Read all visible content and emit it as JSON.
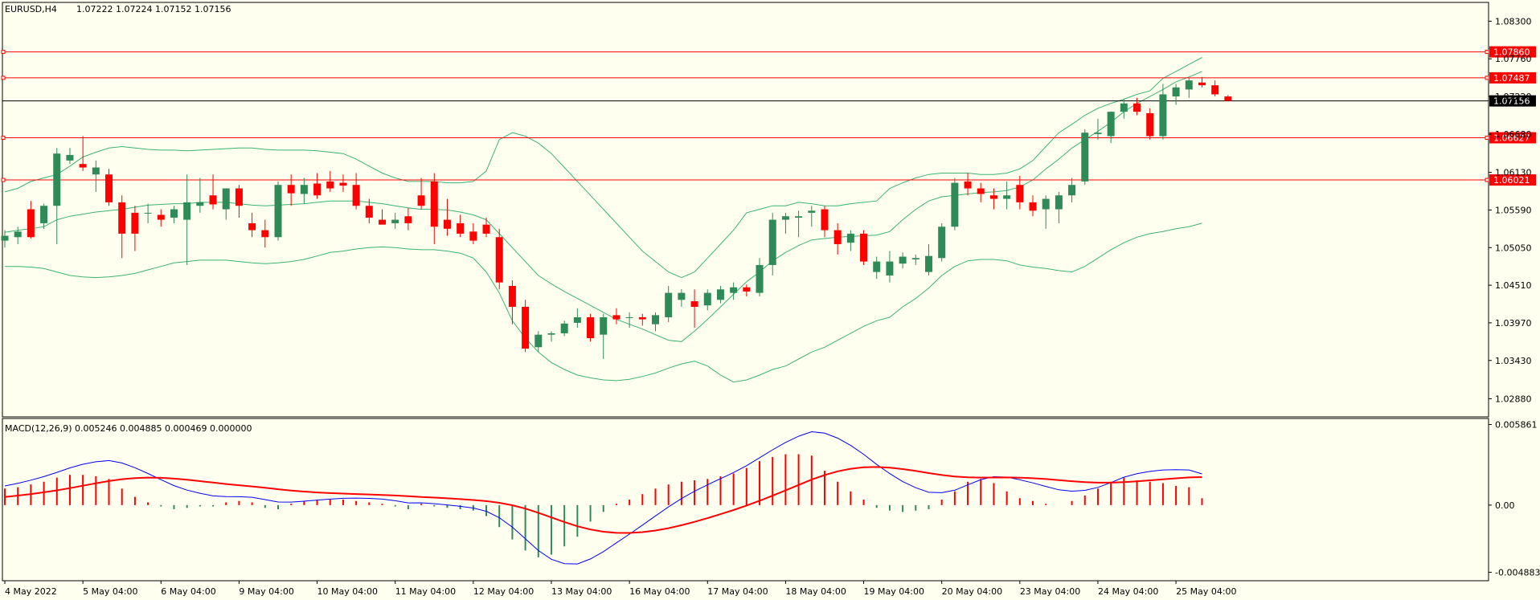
{
  "header": {
    "symbol_label": "EURUSD,H4",
    "ohlc_label": "1.07222 1.07224 1.07152 1.07156"
  },
  "macd": {
    "label": "MACD(12,26,9) 0.005246 0.004885 0.000469 0.000000"
  },
  "colors": {
    "background": "#fffff0",
    "bull": "#2e8b57",
    "bear": "#ff0000",
    "bands": "#3cb371",
    "hline": "#ff0000",
    "current_price_line": "#000000",
    "macd_line": "#0000ff",
    "signal_line": "#ff0000"
  },
  "price_axis": {
    "ticks": [
      "1.08300",
      "1.07760",
      "1.07220",
      "1.06680",
      "1.06130",
      "1.05590",
      "1.05050",
      "1.04510",
      "1.03970",
      "1.03430",
      "1.02880"
    ],
    "ylim": [
      1.0262,
      1.0857
    ]
  },
  "price_markers": [
    {
      "label": "1.07860",
      "value": 1.0786,
      "kind": "level"
    },
    {
      "label": "1.07487",
      "value": 1.07487,
      "kind": "level"
    },
    {
      "label": "1.07156",
      "value": 1.07156,
      "kind": "current"
    },
    {
      "label": "1.06627",
      "value": 1.06627,
      "kind": "level"
    },
    {
      "label": "1.06021",
      "value": 1.06021,
      "kind": "level"
    }
  ],
  "macd_axis": {
    "ticks": [
      "0.005861",
      "0.00",
      "-0.004883"
    ],
    "ylim": [
      -0.0055,
      0.0063
    ]
  },
  "time_axis": {
    "labels": [
      {
        "text": "4 May 2022",
        "bar": 0
      },
      {
        "text": "5 May 04:00",
        "bar": 6
      },
      {
        "text": "6 May 04:00",
        "bar": 12
      },
      {
        "text": "9 May 04:00",
        "bar": 18
      },
      {
        "text": "10 May 04:00",
        "bar": 24
      },
      {
        "text": "11 May 04:00",
        "bar": 30
      },
      {
        "text": "12 May 04:00",
        "bar": 36
      },
      {
        "text": "13 May 04:00",
        "bar": 42
      },
      {
        "text": "16 May 04:00",
        "bar": 48
      },
      {
        "text": "17 May 04:00",
        "bar": 54
      },
      {
        "text": "18 May 04:00",
        "bar": 60
      },
      {
        "text": "19 May 04:00",
        "bar": 66
      },
      {
        "text": "20 May 04:00",
        "bar": 72
      },
      {
        "text": "23 May 04:00",
        "bar": 78
      },
      {
        "text": "24 May 04:00",
        "bar": 84
      },
      {
        "text": "25 May 04:00",
        "bar": 90
      }
    ]
  },
  "chart_data": {
    "type": "candlestick",
    "symbol": "EURUSD",
    "timeframe": "H4",
    "ohlc": [
      [
        1.0515,
        1.053,
        1.0505,
        1.0522
      ],
      [
        1.052,
        1.0535,
        1.051,
        1.0528
      ],
      [
        1.056,
        1.0572,
        1.0518,
        1.052
      ],
      [
        1.054,
        1.0568,
        1.0532,
        1.0565
      ],
      [
        1.0565,
        1.0648,
        1.051,
        1.064
      ],
      [
        1.063,
        1.0648,
        1.0625,
        1.0638
      ],
      [
        1.0625,
        1.0665,
        1.0615,
        1.062
      ],
      [
        1.061,
        1.063,
        1.0585,
        1.062
      ],
      [
        1.061,
        1.0618,
        1.0565,
        1.057
      ],
      [
        1.057,
        1.058,
        1.049,
        1.0525
      ],
      [
        1.0555,
        1.0565,
        1.05,
        1.0525
      ],
      [
        1.0555,
        1.0568,
        1.054,
        1.0555
      ],
      [
        1.0552,
        1.056,
        1.0535,
        1.0545
      ],
      [
        1.0548,
        1.0565,
        1.054,
        1.056
      ],
      [
        1.0545,
        1.061,
        1.048,
        1.057
      ],
      [
        1.0565,
        1.0605,
        1.0555,
        1.057
      ],
      [
        1.058,
        1.061,
        1.056,
        1.0567
      ],
      [
        1.056,
        1.059,
        1.0545,
        1.059
      ],
      [
        1.059,
        1.0595,
        1.0548,
        1.0565
      ],
      [
        1.054,
        1.0555,
        1.052,
        1.053
      ],
      [
        1.053,
        1.0545,
        1.0505,
        1.052
      ],
      [
        1.052,
        1.06,
        1.0515,
        1.0595
      ],
      [
        1.0595,
        1.061,
        1.0565,
        1.0583
      ],
      [
        1.0582,
        1.0605,
        1.0568,
        1.0595
      ],
      [
        1.0597,
        1.0612,
        1.0575,
        1.058
      ],
      [
        1.06,
        1.0615,
        1.0585,
        1.059
      ],
      [
        1.0598,
        1.061,
        1.0585,
        1.0594
      ],
      [
        1.0595,
        1.0612,
        1.056,
        1.0565
      ],
      [
        1.0565,
        1.0575,
        1.054,
        1.0548
      ],
      [
        1.0545,
        1.056,
        1.0538,
        1.0538
      ],
      [
        1.054,
        1.0555,
        1.0532,
        1.0545
      ],
      [
        1.055,
        1.0562,
        1.053,
        1.054
      ],
      [
        1.058,
        1.0605,
        1.056,
        1.0565
      ],
      [
        1.06,
        1.0612,
        1.051,
        1.0535
      ],
      [
        1.0545,
        1.0575,
        1.0522,
        1.0532
      ],
      [
        1.054,
        1.0552,
        1.052,
        1.0525
      ],
      [
        1.0528,
        1.054,
        1.051,
        1.0515
      ],
      [
        1.0538,
        1.0548,
        1.052,
        1.0525
      ],
      [
        1.052,
        1.0532,
        1.0445,
        1.0455
      ],
      [
        1.045,
        1.0458,
        1.0395,
        1.042
      ],
      [
        1.042,
        1.043,
        1.0355,
        1.036
      ],
      [
        1.0362,
        1.0385,
        1.0355,
        1.038
      ],
      [
        1.038,
        1.0385,
        1.037,
        1.0382
      ],
      [
        1.0382,
        1.04,
        1.0378,
        1.0396
      ],
      [
        1.0397,
        1.0418,
        1.039,
        1.0405
      ],
      [
        1.0405,
        1.041,
        1.037,
        1.0375
      ],
      [
        1.038,
        1.041,
        1.0345,
        1.0405
      ],
      [
        1.0408,
        1.0418,
        1.0395,
        1.0402
      ],
      [
        1.0405,
        1.0412,
        1.039,
        1.0405
      ],
      [
        1.0405,
        1.041,
        1.0393,
        1.0402
      ],
      [
        1.0395,
        1.0412,
        1.0385,
        1.0408
      ],
      [
        1.0405,
        1.045,
        1.0398,
        1.044
      ],
      [
        1.043,
        1.0445,
        1.042,
        1.044
      ],
      [
        1.0428,
        1.0445,
        1.039,
        1.042
      ],
      [
        1.0422,
        1.0445,
        1.0415,
        1.044
      ],
      [
        1.043,
        1.045,
        1.0425,
        1.0445
      ],
      [
        1.044,
        1.0455,
        1.043,
        1.0448
      ],
      [
        1.0448,
        1.0452,
        1.0435,
        1.0442
      ],
      [
        1.044,
        1.049,
        1.0435,
        1.048
      ],
      [
        1.048,
        1.0555,
        1.0465,
        1.0545
      ],
      [
        1.0545,
        1.0555,
        1.0525,
        1.055
      ],
      [
        1.0548,
        1.0558,
        1.052,
        1.055
      ],
      [
        1.0555,
        1.0565,
        1.0535,
        1.0558
      ],
      [
        1.056,
        1.0565,
        1.052,
        1.053
      ],
      [
        1.053,
        1.054,
        1.0495,
        1.051
      ],
      [
        1.0512,
        1.053,
        1.05,
        1.0525
      ],
      [
        1.0525,
        1.053,
        1.048,
        1.0485
      ],
      [
        1.047,
        1.0492,
        1.046,
        1.0485
      ],
      [
        1.0465,
        1.05,
        1.0455,
        1.0485
      ],
      [
        1.0482,
        1.0498,
        1.0475,
        1.0492
      ],
      [
        1.0488,
        1.0495,
        1.048,
        1.049
      ],
      [
        1.047,
        1.051,
        1.0465,
        1.0493
      ],
      [
        1.049,
        1.054,
        1.0485,
        1.0535
      ],
      [
        1.0535,
        1.0605,
        1.053,
        1.0598
      ],
      [
        1.06,
        1.0612,
        1.058,
        1.059
      ],
      [
        1.059,
        1.0598,
        1.057,
        1.0582
      ],
      [
        1.058,
        1.059,
        1.056,
        1.0575
      ],
      [
        1.0575,
        1.06,
        1.056,
        1.058
      ],
      [
        1.0595,
        1.0608,
        1.056,
        1.057
      ],
      [
        1.057,
        1.058,
        1.055,
        1.0558
      ],
      [
        1.056,
        1.058,
        1.0532,
        1.0575
      ],
      [
        1.056,
        1.0585,
        1.054,
        1.058
      ],
      [
        1.058,
        1.0605,
        1.057,
        1.0595
      ],
      [
        1.06,
        1.0675,
        1.0595,
        1.067
      ],
      [
        1.0668,
        1.069,
        1.066,
        1.067
      ],
      [
        1.0665,
        1.07,
        1.0655,
        1.07
      ],
      [
        1.07,
        1.0718,
        1.069,
        1.0712
      ],
      [
        1.0712,
        1.072,
        1.0695,
        1.07
      ],
      [
        1.0698,
        1.0705,
        1.066,
        1.0665
      ],
      [
        1.0665,
        1.074,
        1.066,
        1.0725
      ],
      [
        1.0722,
        1.074,
        1.071,
        1.0735
      ],
      [
        1.0732,
        1.0748,
        1.072,
        1.0745
      ],
      [
        1.0742,
        1.075,
        1.0735,
        1.0738
      ],
      [
        1.0738,
        1.0745,
        1.0722,
        1.0725
      ],
      [
        1.0722,
        1.0724,
        1.0715,
        1.07156
      ]
    ],
    "bollinger": {
      "upper": [
        1.0585,
        1.059,
        1.06,
        1.0605,
        1.061,
        1.0622,
        1.0635,
        1.0642,
        1.0648,
        1.065,
        1.0648,
        1.0646,
        1.0645,
        1.0645,
        1.0644,
        1.0645,
        1.0646,
        1.0647,
        1.0648,
        1.0648,
        1.0646,
        1.0645,
        1.0645,
        1.0645,
        1.0644,
        1.0642,
        1.064,
        1.0632,
        1.0622,
        1.0612,
        1.0605,
        1.06,
        1.06,
        1.06,
        1.0598,
        1.0598,
        1.06,
        1.0615,
        1.066,
        1.067,
        1.0665,
        1.0655,
        1.064,
        1.062,
        1.06,
        1.058,
        1.056,
        1.054,
        1.052,
        1.05,
        1.0485,
        1.047,
        1.0462,
        1.047,
        1.049,
        1.051,
        1.053,
        1.0555,
        1.056,
        1.0565,
        1.0565,
        1.057,
        1.0568,
        1.0565,
        1.0565,
        1.0568,
        1.057,
        1.0572,
        1.059,
        1.0598,
        1.0605,
        1.061,
        1.0612,
        1.0612,
        1.0612,
        1.061,
        1.061,
        1.0612,
        1.0618,
        1.063,
        1.065,
        1.067,
        1.0682,
        1.0695,
        1.0705,
        1.0712,
        1.0718,
        1.0725,
        1.073,
        1.0748,
        1.0758,
        1.0768,
        1.0778
      ],
      "middle": [
        1.0527,
        1.053,
        1.0532,
        1.0535,
        1.0545,
        1.055,
        1.0553,
        1.0556,
        1.0558,
        1.056,
        1.0563,
        1.0566,
        1.0567,
        1.0568,
        1.0568,
        1.057,
        1.057,
        1.057,
        1.0568,
        1.0566,
        1.0565,
        1.0566,
        1.0567,
        1.0568,
        1.057,
        1.0572,
        1.0572,
        1.0572,
        1.057,
        1.0568,
        1.0565,
        1.0562,
        1.056,
        1.056,
        1.0559,
        1.0556,
        1.0552,
        1.0545,
        1.0525,
        1.0505,
        1.0485,
        1.0465,
        1.0453,
        1.0442,
        1.0432,
        1.0422,
        1.0412,
        1.0402,
        1.0395,
        1.0388,
        1.038,
        1.0372,
        1.037,
        1.0385,
        1.0402,
        1.042,
        1.0438,
        1.0456,
        1.047,
        1.0486,
        1.0498,
        1.0508,
        1.0516,
        1.0518,
        1.052,
        1.0521,
        1.0522,
        1.0523,
        1.0528,
        1.0545,
        1.056,
        1.0572,
        1.0578,
        1.058,
        1.0582,
        1.0584,
        1.0585,
        1.0587,
        1.0592,
        1.0602,
        1.0618,
        1.0632,
        1.0648,
        1.066,
        1.0672,
        1.0685,
        1.07,
        1.0712,
        1.0722,
        1.0732,
        1.0743,
        1.075,
        1.0758
      ],
      "lower": [
        1.0478,
        1.0478,
        1.0477,
        1.0475,
        1.047,
        1.0465,
        1.0463,
        1.0462,
        1.0463,
        1.0465,
        1.0468,
        1.0473,
        1.0478,
        1.0483,
        1.0485,
        1.0487,
        1.0487,
        1.0487,
        1.0485,
        1.0483,
        1.0482,
        1.0483,
        1.0485,
        1.0488,
        1.0493,
        1.0498,
        1.05,
        1.0503,
        1.0505,
        1.0506,
        1.0505,
        1.0503,
        1.0502,
        1.0502,
        1.05,
        1.0497,
        1.049,
        1.047,
        1.044,
        1.04,
        1.0375,
        1.0355,
        1.034,
        1.033,
        1.0322,
        1.0318,
        1.0315,
        1.0314,
        1.0316,
        1.032,
        1.0325,
        1.0332,
        1.0338,
        1.0342,
        1.0335,
        1.0322,
        1.0312,
        1.0315,
        1.0322,
        1.033,
        1.0335,
        1.0345,
        1.0355,
        1.0362,
        1.0372,
        1.0382,
        1.0392,
        1.04,
        1.0405,
        1.042,
        1.0432,
        1.0447,
        1.0465,
        1.0478,
        1.0486,
        1.0488,
        1.0488,
        1.0486,
        1.048,
        1.0477,
        1.0475,
        1.0472,
        1.047,
        1.0478,
        1.049,
        1.0502,
        1.0512,
        1.052,
        1.0525,
        1.0528,
        1.0532,
        1.0535,
        1.054
      ]
    },
    "macd": {
      "histogram": [
        0.0012,
        0.0013,
        0.0015,
        0.0017,
        0.002,
        0.0022,
        0.0022,
        0.0021,
        0.0019,
        0.0012,
        0.0006,
        0.0002,
        -0.0001,
        -0.0003,
        -0.0002,
        -0.0001,
        -0.0001,
        0.0002,
        0.0003,
        0.0002,
        -0.0002,
        -0.0003,
        0.0001,
        0.0003,
        0.0004,
        0.0004,
        0.0004,
        0.0003,
        0.0002,
        0.0001,
        -0.0001,
        -0.0003,
        0.0001,
        -0.0001,
        -0.0002,
        -0.0003,
        -0.0004,
        -0.0008,
        -0.0016,
        -0.0025,
        -0.0033,
        -0.0038,
        -0.0036,
        -0.003,
        -0.0023,
        -0.0012,
        -0.0005,
        0.0001,
        0.0004,
        0.0008,
        0.0012,
        0.0015,
        0.0017,
        0.0018,
        0.0019,
        0.0021,
        0.0023,
        0.0027,
        0.0032,
        0.0035,
        0.0037,
        0.0037,
        0.0036,
        0.0025,
        0.0017,
        0.001,
        0.0004,
        -0.0002,
        -0.0004,
        -0.0005,
        -0.0004,
        -0.0003,
        0.0004,
        0.001,
        0.0017,
        0.0019,
        0.0016,
        0.001,
        0.0005,
        0.0003,
        0.0001,
        0.0,
        0.0003,
        0.0007,
        0.0012,
        0.0017,
        0.002,
        0.0018,
        0.0017,
        0.0016,
        0.0014,
        0.0013,
        0.0005
      ]
    }
  }
}
